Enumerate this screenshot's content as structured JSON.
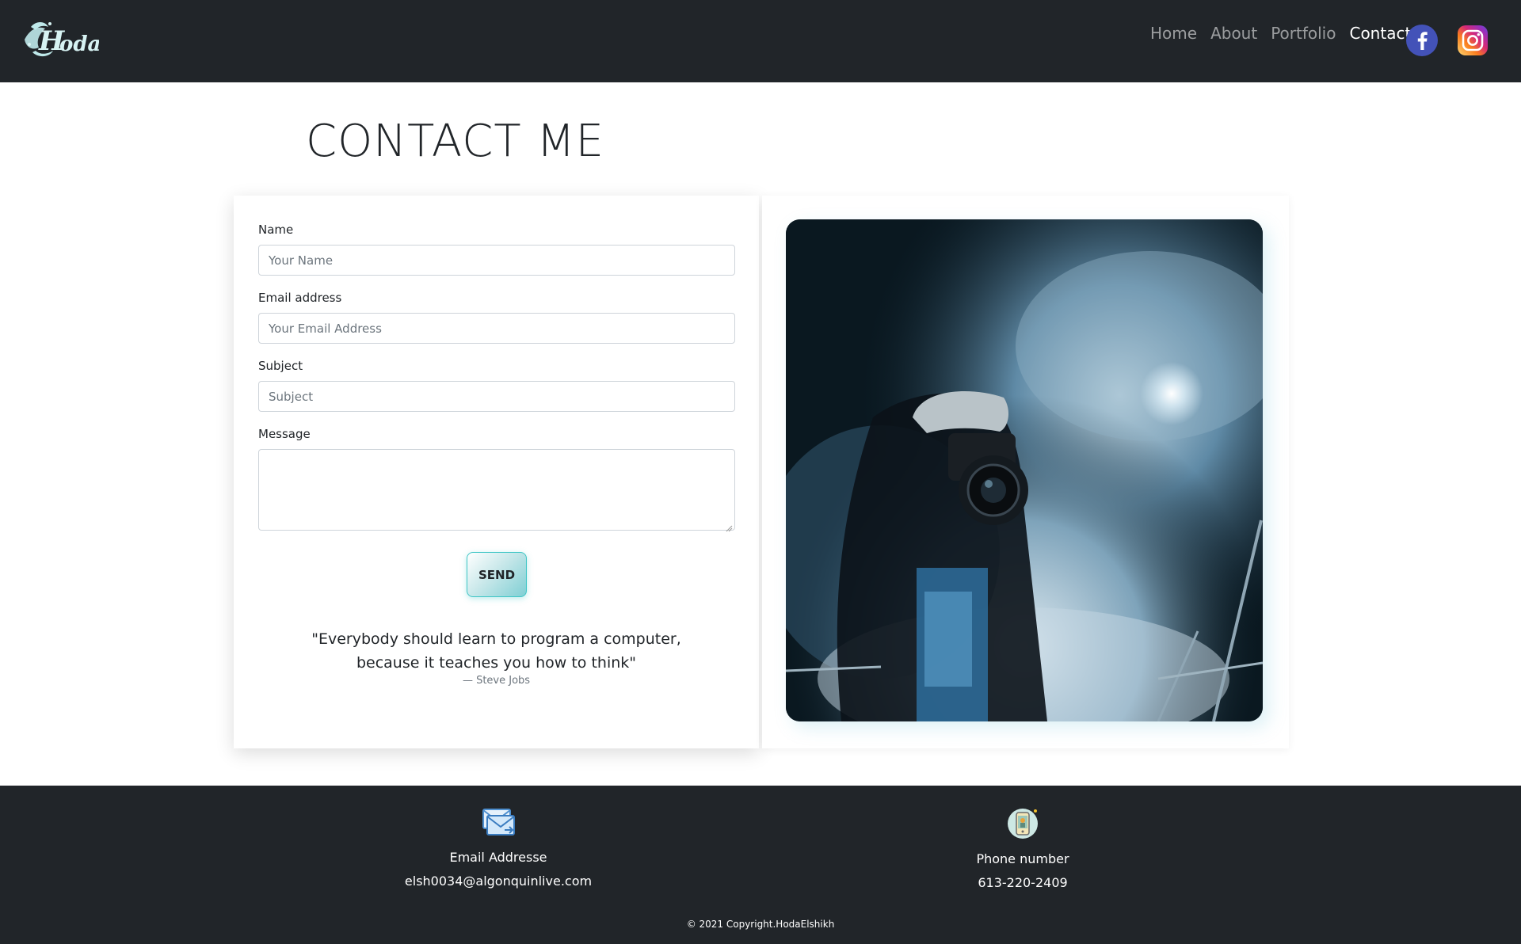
{
  "header": {
    "logo_text": "Hoda",
    "nav": [
      {
        "label": "Home",
        "active": false
      },
      {
        "label": "About",
        "active": false
      },
      {
        "label": "Portfolio",
        "active": false
      },
      {
        "label": "Contact",
        "active": true
      }
    ],
    "social": [
      "facebook-icon",
      "instagram-icon"
    ]
  },
  "main": {
    "title": "CONTACT ME",
    "form": {
      "name_label": "Name",
      "name_placeholder": "Your Name",
      "email_label": "Email address",
      "email_placeholder": "Your Email Address",
      "subject_label": "Subject",
      "subject_placeholder": "Subject",
      "message_label": "Message",
      "send_label": "SEND"
    },
    "quote": {
      "text": "\"Everybody should learn to program a computer, because it teaches you how to think\"",
      "author": "— Steve Jobs"
    }
  },
  "footer": {
    "email_label": "Email Addresse",
    "email_value": "elsh0034@algonquinlive.com",
    "phone_label": "Phone number",
    "phone_value": "613-220-2409",
    "copyright": "© 2021 Copyright.HodaElshikh"
  },
  "colors": {
    "navbar_bg": "#212529",
    "accent": "#3fc6c6",
    "facebook": "#3b5998"
  }
}
